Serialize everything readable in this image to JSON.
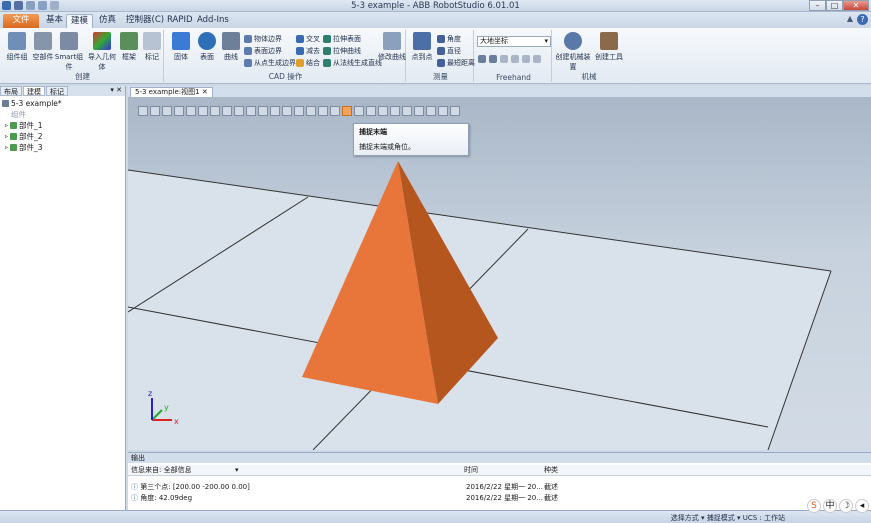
{
  "window": {
    "title": "5-3 example - ABB RobotStudio 6.01.01",
    "min": "–",
    "max": "□",
    "close": "✕"
  },
  "tabs": {
    "file": "文件 (F)",
    "basic": "基本",
    "modeling": "建模",
    "simulation": "仿真",
    "controller": "控制器(C)",
    "rapid": "RAPID",
    "addins": "Add-Ins"
  },
  "ribbon": {
    "create": {
      "label": "创建",
      "group_component": "组件组",
      "empty_part": "空部件",
      "smart_component": "Smart组件",
      "import_geometry": "导入几何体",
      "frame": "框架",
      "mark": "标记"
    },
    "cad": {
      "label": "CAD 操作",
      "solid": "固体",
      "surface": "表面",
      "curve": "曲线",
      "body_edge": "物体边界",
      "surface_edge": "表面边界",
      "from_points": "从点生成边界",
      "intersect": "交叉",
      "subtract": "减去",
      "union": "结合",
      "extrude_surface": "拉伸表面",
      "extrude_curve": "拉伸曲线",
      "from_normal": "从法线生成直线",
      "modify_curve": "修改曲线"
    },
    "measure": {
      "label": "测量",
      "point_to_point": "点到点",
      "angle": "角度",
      "diameter": "直径",
      "min_distance": "最短距离"
    },
    "freehand": {
      "label": "Freehand",
      "coord_select": "大地坐标"
    },
    "mechanism": {
      "label": "机械",
      "create_mechanism": "创建机械装置",
      "create_tool": "创建工具"
    }
  },
  "left_panel": {
    "tabs": [
      "布局",
      "建模",
      "标记"
    ],
    "close": "▾ ✕",
    "tree": [
      {
        "label": "5-3 example*"
      },
      {
        "label": "组件"
      },
      {
        "label": "部件_1"
      },
      {
        "label": "部件_2"
      },
      {
        "label": "部件_3"
      }
    ]
  },
  "view": {
    "tab": "5-3 example:视图1 ✕",
    "tooltip_title": "捕捉末端",
    "tooltip_body": "捕捉末端或角位。"
  },
  "output": {
    "title": "输出",
    "filter_label": "信息来自: 全部信息",
    "col_time": "时间",
    "col_category": "种类",
    "rows": [
      {
        "msg": "第三个点: [200.00 -200.00 0.00]",
        "time": "2016/2/22 星期一 20...",
        "cat": "截述"
      },
      {
        "msg": "角度: 42.09deg",
        "time": "2016/2/22 星期一 20...",
        "cat": "截述"
      }
    ]
  },
  "status": {
    "text": "选择方式 ▾ 捕捉模式 ▾ UCS : 工作站"
  },
  "ime": [
    "S",
    "中",
    "☽",
    "◂"
  ]
}
